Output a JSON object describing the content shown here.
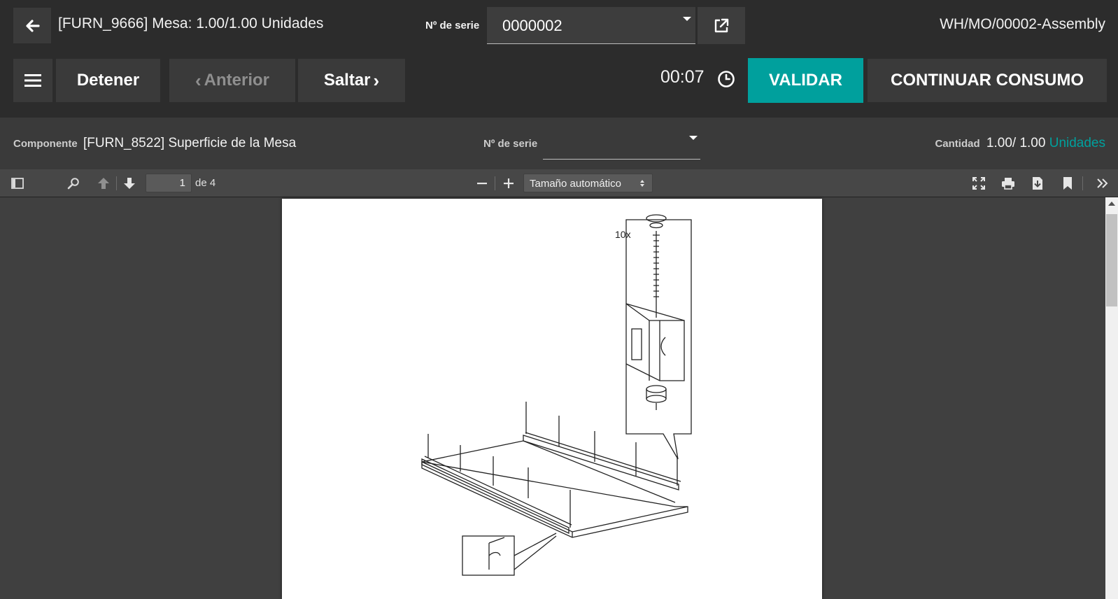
{
  "header": {
    "title": "[FURN_9666] Mesa: 1.00/1.00 Unidades",
    "serial_label": "Nº de serie",
    "serial_value": "0000002",
    "mo_reference": "WH/MO/00002-Assembly"
  },
  "actions": {
    "menu_icon": "hamburger-icon",
    "detener_label": "Detener",
    "anterior_label": "Anterior",
    "saltar_label": "Saltar",
    "timer": "00:07",
    "validar_label": "VALIDAR",
    "continuar_label": "CONTINUAR CONSUMO"
  },
  "component": {
    "label": "Componente",
    "name": "[FURN_8522] Superficie de la Mesa",
    "serial_label": "Nº de serie",
    "serial_value": "",
    "qty_label": "Cantidad",
    "qty_value": "1.00/ 1.00",
    "qty_unit": "Unidades"
  },
  "pdf_toolbar": {
    "page_number": "1",
    "page_total": "de 4",
    "zoom": "Tamaño automático"
  },
  "drawing": {
    "callout_label": "10x"
  },
  "colors": {
    "accent": "#00a09d",
    "background": "#333333",
    "header": "#2c2c2c"
  }
}
